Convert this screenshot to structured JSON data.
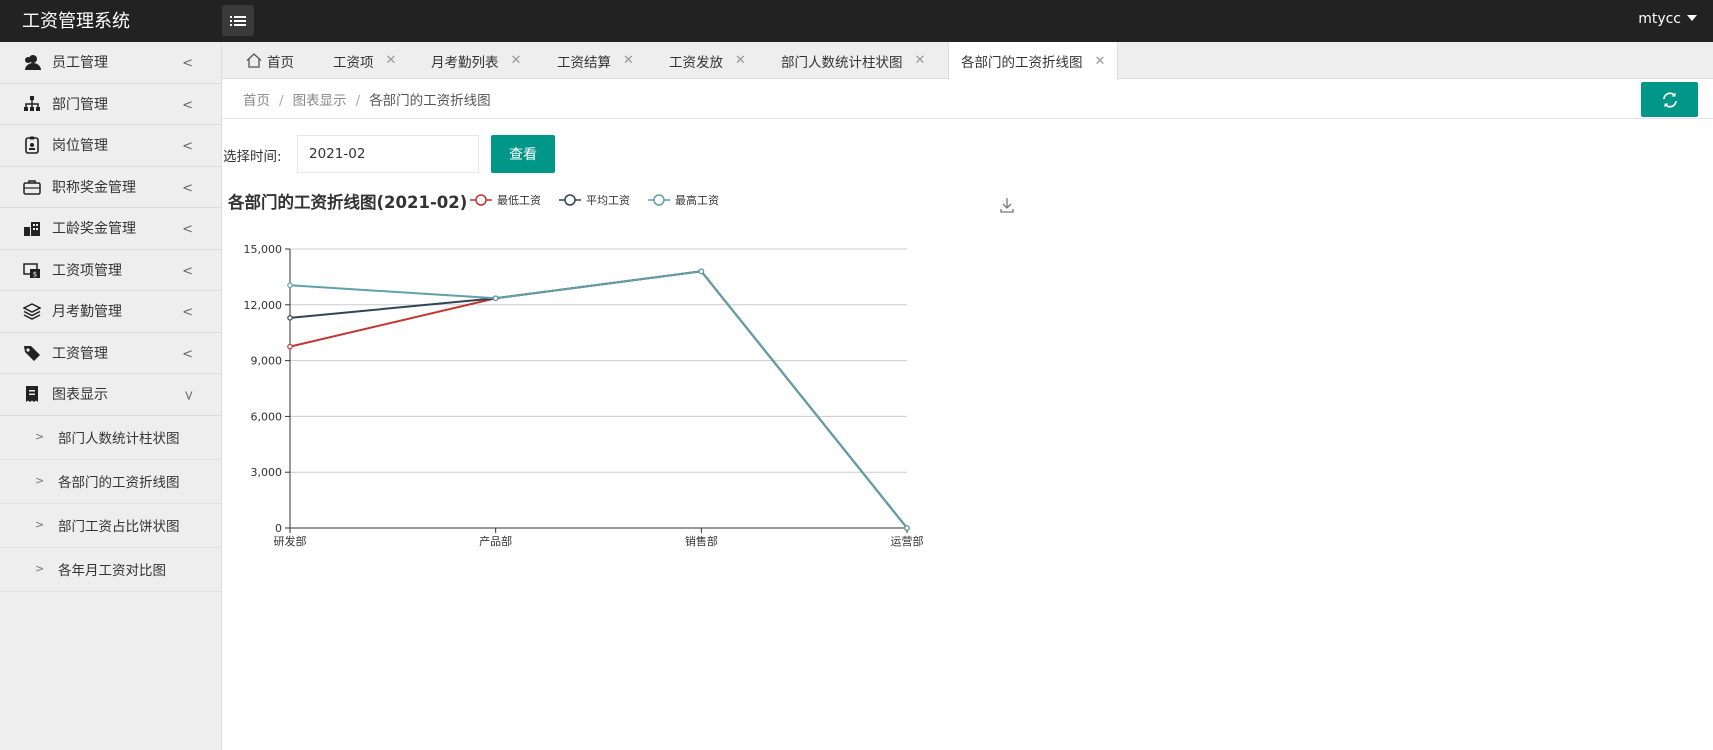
{
  "app": {
    "title": "工资管理系统",
    "user": "mtycc"
  },
  "sidebar": {
    "items": [
      {
        "label": "员工管理",
        "icon": "users-icon"
      },
      {
        "label": "部门管理",
        "icon": "sitemap-icon"
      },
      {
        "label": "岗位管理",
        "icon": "id-badge-icon"
      },
      {
        "label": "职称奖金管理",
        "icon": "briefcase-icon"
      },
      {
        "label": "工龄奖金管理",
        "icon": "buildings-icon"
      },
      {
        "label": "工资项管理",
        "icon": "money-icon"
      },
      {
        "label": "月考勤管理",
        "icon": "layers-icon"
      },
      {
        "label": "工资管理",
        "icon": "tags-icon"
      },
      {
        "label": "图表显示",
        "icon": "receipt-icon"
      }
    ],
    "subitems": [
      {
        "label": "部门人数统计柱状图"
      },
      {
        "label": "各部门的工资折线图"
      },
      {
        "label": "部门工资占比饼状图"
      },
      {
        "label": "各年月工资对比图"
      }
    ]
  },
  "tabs": [
    {
      "label": "首页"
    },
    {
      "label": "工资项"
    },
    {
      "label": "月考勤列表"
    },
    {
      "label": "工资结算"
    },
    {
      "label": "工资发放"
    },
    {
      "label": "部门人数统计柱状图"
    },
    {
      "label": "各部门的工资折线图"
    }
  ],
  "breadcrumb": {
    "home": "首页",
    "section": "图表显示",
    "current": "各部门的工资折线图",
    "sep": "/"
  },
  "filter": {
    "label": "选择时间:",
    "value": "2021-02",
    "button": "查看"
  },
  "colors": {
    "accent": "#009688",
    "header": "#222222",
    "sidebar": "#eeeeee"
  },
  "chart_data": {
    "type": "line",
    "title": "各部门的工资折线图(2021-02)",
    "categories": [
      "研发部",
      "产品部",
      "销售部",
      "运营部"
    ],
    "ylim": [
      0,
      15000
    ],
    "yticks": [
      0,
      3000,
      6000,
      9000,
      12000,
      15000
    ],
    "ytick_labels": [
      "0",
      "3,000",
      "6,000",
      "9,000",
      "12,000",
      "15,000"
    ],
    "grid": true,
    "legend": "top",
    "series": [
      {
        "name": "最低工资",
        "color": "#c23531",
        "values": [
          9750,
          12350,
          13800,
          0
        ]
      },
      {
        "name": "平均工资",
        "color": "#2f4554",
        "values": [
          11300,
          12350,
          13800,
          0
        ]
      },
      {
        "name": "最高工资",
        "color": "#61a0a8",
        "values": [
          13050,
          12350,
          13800,
          0
        ]
      }
    ]
  }
}
